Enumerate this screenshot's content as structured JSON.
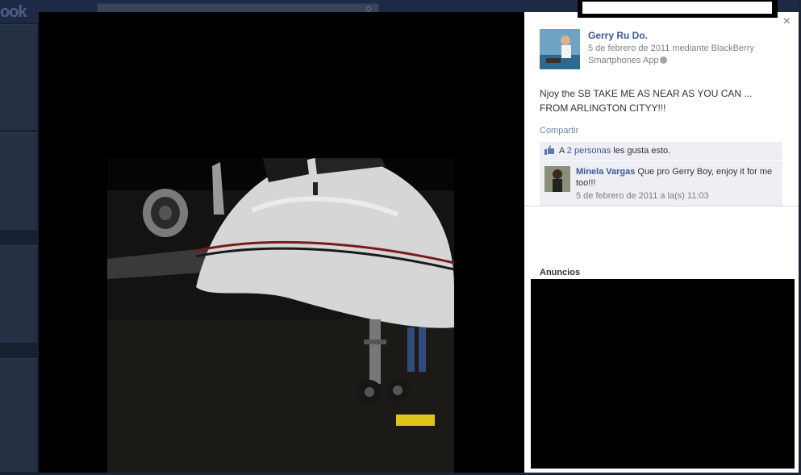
{
  "background": {
    "logo_fragment": "ook"
  },
  "post": {
    "author": "Gerry Ru Do.",
    "meta_line": "5 de febrero de 2011 mediante BlackBerry Smartphones App",
    "text": "Njoy the SB TAKE ME AS NEAR AS YOU CAN ... FROM ARLINGTON CITYY!!!",
    "share_label": "Compartir"
  },
  "likes": {
    "prefix": "A ",
    "count_link": "2 personas",
    "suffix": " les gusta esto."
  },
  "comments": [
    {
      "author": "Minela Vargas",
      "text": " Que pro Gerry Boy, enjoy it for me too!!!",
      "timestamp": "5 de febrero de 2011 a la(s) 11:03"
    }
  ],
  "ads": {
    "title": "Anuncios"
  },
  "controls": {
    "close_glyph": "×"
  },
  "icons": {
    "search": "search-icon",
    "like": "thumbs-up-icon",
    "globe": "globe-icon",
    "close": "close-icon"
  },
  "colors": {
    "link": "#3b5998",
    "muted": "#808080",
    "ufi_bg": "#edeff4",
    "overlay_bg": "#000000"
  }
}
